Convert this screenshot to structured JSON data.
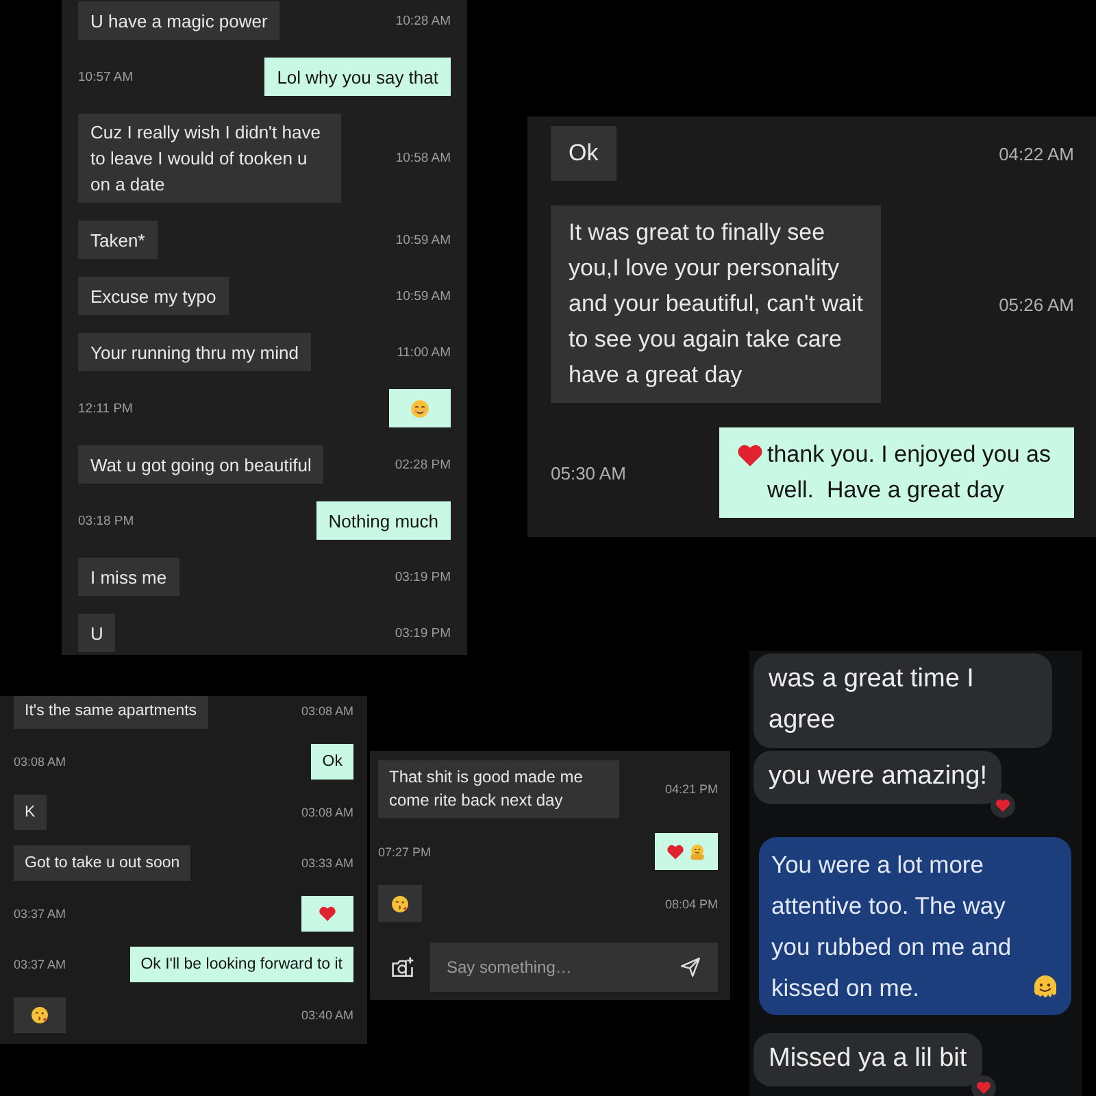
{
  "panels": [
    {
      "kind": "timestamped",
      "messages": [
        {
          "kind": "text",
          "sent": false,
          "text": "U have a magic power",
          "time": "10:28 AM"
        },
        {
          "kind": "text",
          "sent": true,
          "text": "Lol why you say that",
          "time": "10:57 AM"
        },
        {
          "kind": "text",
          "sent": false,
          "text": "Cuz I really wish I didn't have to leave I would of tooken u on a date",
          "time": "10:58 AM"
        },
        {
          "kind": "text",
          "sent": false,
          "text": "Taken*",
          "time": "10:59 AM"
        },
        {
          "kind": "text",
          "sent": false,
          "text": "Excuse my typo",
          "time": "10:59 AM"
        },
        {
          "kind": "text",
          "sent": false,
          "text": "Your running thru my mind",
          "time": "11:00 AM"
        },
        {
          "kind": "smile",
          "sent": true,
          "time": "12:11 PM"
        },
        {
          "kind": "text",
          "sent": false,
          "text": "Wat u got going on beautiful",
          "time": "02:28 PM"
        },
        {
          "kind": "text",
          "sent": true,
          "text": "Nothing much",
          "time": "03:18 PM"
        },
        {
          "kind": "text",
          "sent": false,
          "text": "I miss me",
          "time": "03:19 PM"
        },
        {
          "kind": "text",
          "sent": false,
          "text": "U",
          "time": "03:19 PM"
        }
      ]
    },
    {
      "kind": "timestamped",
      "messages": [
        {
          "kind": "text",
          "sent": false,
          "text": "Ok",
          "time": "04:22 AM"
        },
        {
          "kind": "text",
          "sent": false,
          "text": "It was great to finally see\nyou,I love your personality\nand your beautiful, can't wait\nto see you again take care\nhave a great day",
          "time": "05:26 AM"
        },
        {
          "kind": "hearttext",
          "sent": true,
          "text": "thank you. I enjoyed you as well.  Have a great day",
          "time": "05:30 AM"
        }
      ]
    },
    {
      "kind": "timestamped",
      "messages": [
        {
          "kind": "text",
          "sent": false,
          "text": "It's the same apartments",
          "time": "03:08 AM"
        },
        {
          "kind": "text",
          "sent": true,
          "text": "Ok",
          "time": "03:08 AM"
        },
        {
          "kind": "text",
          "sent": false,
          "text": "K",
          "time": "03:08 AM"
        },
        {
          "kind": "text",
          "sent": false,
          "text": "Got to take u out soon",
          "time": "03:33 AM"
        },
        {
          "kind": "heart",
          "sent": true,
          "time": "03:37 AM"
        },
        {
          "kind": "text",
          "sent": true,
          "text": "Ok I'll be looking forward to it",
          "time": "03:37 AM"
        },
        {
          "kind": "kiss",
          "sent": false,
          "time": "03:40 AM"
        }
      ]
    },
    {
      "kind": "timestamped",
      "messages": [
        {
          "kind": "text",
          "sent": false,
          "text": "That shit is good made me come rite back next day",
          "time": "04:21 PM"
        },
        {
          "kind": "hearthug",
          "sent": true,
          "time": "07:27 PM"
        },
        {
          "kind": "kiss",
          "sent": false,
          "time": "08:04 PM"
        }
      ],
      "composer": {
        "placeholder": "Say something…"
      }
    },
    {
      "kind": "rounded",
      "messages": [
        {
          "kind": "text",
          "sent": false,
          "text": "was a great time I agree",
          "reacted": false
        },
        {
          "kind": "text",
          "sent": false,
          "text": "you were amazing!",
          "reacted": true
        },
        {
          "kind": "textmelting",
          "sent": true,
          "text": "You were a lot more attentive too. The way you rubbed on me and kissed on me.",
          "reacted": false
        },
        {
          "kind": "text",
          "sent": false,
          "text": "Missed ya a lil bit",
          "reacted": true
        }
      ]
    }
  ]
}
